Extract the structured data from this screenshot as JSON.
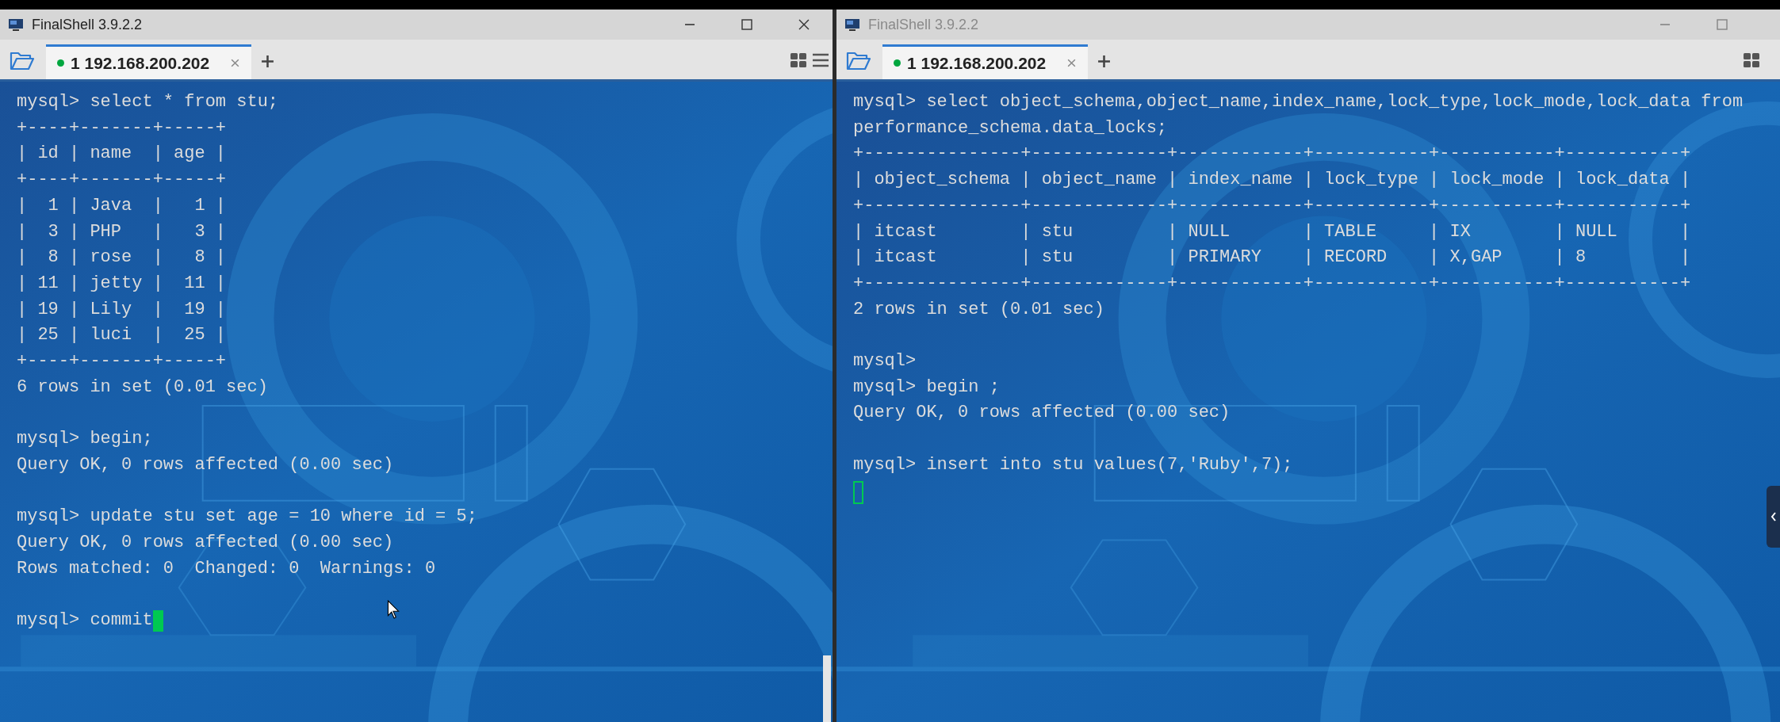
{
  "windows": [
    {
      "title": "FinalShell 3.9.2.2",
      "focused": true,
      "controls": [
        {
          "kind": "minimize"
        },
        {
          "kind": "maximize"
        },
        {
          "kind": "close"
        }
      ],
      "tabs": [
        {
          "label": "1 192.168.200.202",
          "selected": true,
          "connected": true
        }
      ],
      "tools": [
        {
          "kind": "grid"
        },
        {
          "kind": "menu"
        }
      ],
      "terminal": {
        "cursor_after_last_line": true,
        "blocks": [
          [
            "mysql> select * from stu;",
            "+----+-------+-----+",
            "| id | name  | age |",
            "+----+-------+-----+",
            "|  1 | Java  |   1 |",
            "|  3 | PHP   |   3 |",
            "|  8 | rose  |   8 |",
            "| 11 | jetty |  11 |",
            "| 19 | Lily  |  19 |",
            "| 25 | luci  |  25 |",
            "+----+-------+-----+",
            "6 rows in set (0.01 sec)"
          ],
          [
            "mysql> begin;",
            "Query OK, 0 rows affected (0.00 sec)"
          ],
          [
            "mysql> update stu set age = 10 where id = 5;",
            "Query OK, 0 rows affected (0.00 sec)",
            "Rows matched: 0  Changed: 0  Warnings: 0"
          ],
          [
            "mysql> commit"
          ]
        ]
      }
    },
    {
      "title": "FinalShell 3.9.2.2",
      "focused": false,
      "controls": [
        {
          "kind": "minimize"
        },
        {
          "kind": "maximize"
        }
      ],
      "tabs": [
        {
          "label": "1 192.168.200.202",
          "selected": true,
          "connected": true
        }
      ],
      "tools": [
        {
          "kind": "grid"
        }
      ],
      "terminal": {
        "cursor_after_last_line": false,
        "blocks": [
          [
            "mysql> select object_schema,object_name,index_name,lock_type,lock_mode,lock_data from",
            "performance_schema.data_locks;",
            "+---------------+-------------+------------+-----------+-----------+-----------+",
            "| object_schema | object_name | index_name | lock_type | lock_mode | lock_data |",
            "+---------------+-------------+------------+-----------+-----------+-----------+",
            "| itcast        | stu         | NULL       | TABLE     | IX        | NULL      |",
            "| itcast        | stu         | PRIMARY    | RECORD    | X,GAP     | 8         |",
            "+---------------+-------------+------------+-----------+-----------+-----------+",
            "2 rows in set (0.01 sec)"
          ],
          [
            "mysql>",
            "mysql> begin ;",
            "Query OK, 0 rows affected (0.00 sec)"
          ],
          [
            "mysql> insert into stu values(7,'Ruby',7);"
          ]
        ]
      }
    }
  ]
}
